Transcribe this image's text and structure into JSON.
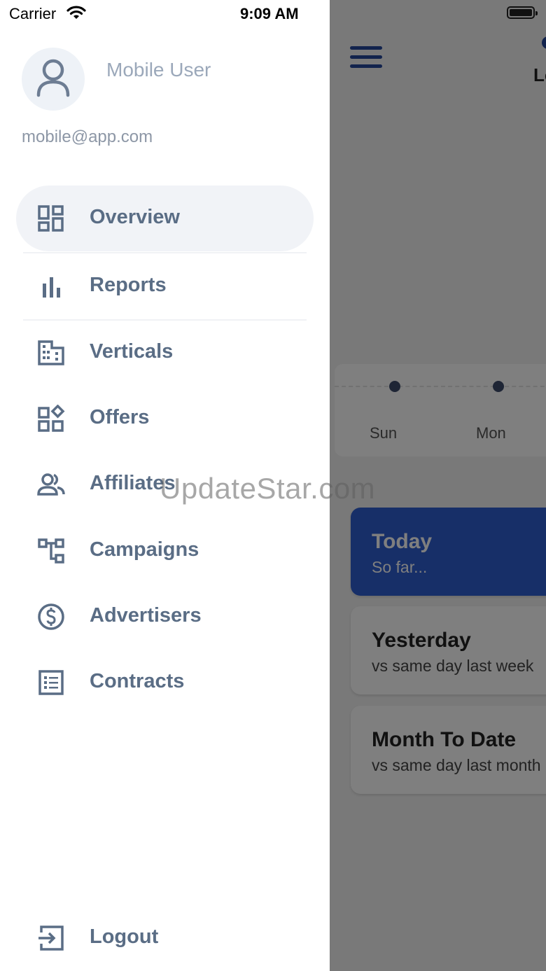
{
  "status_bar": {
    "carrier": "Carrier",
    "time": "9:09 AM"
  },
  "drawer": {
    "user_name": "Mobile User",
    "email": "mobile@app.com",
    "menu": [
      {
        "label": "Overview",
        "icon": "dashboard-icon",
        "active": true
      },
      {
        "label": "Reports",
        "icon": "bar-chart-icon"
      },
      {
        "label": "Verticals",
        "icon": "building-icon"
      },
      {
        "label": "Offers",
        "icon": "widgets-icon"
      },
      {
        "label": "Affiliates",
        "icon": "people-icon"
      },
      {
        "label": "Campaigns",
        "icon": "account-tree-icon"
      },
      {
        "label": "Advertisers",
        "icon": "dollar-circle-icon"
      },
      {
        "label": "Contracts",
        "icon": "list-document-icon"
      }
    ],
    "logout_label": "Logout"
  },
  "background": {
    "header_partial": "Lo",
    "chart_day_labels": [
      "Sun",
      "Mon"
    ],
    "cards": [
      {
        "title": "Today",
        "subtitle": "So far...",
        "active": true
      },
      {
        "title": "Yesterday",
        "subtitle": "vs same day last week"
      },
      {
        "title": "Month To Date",
        "subtitle": "vs same day last month"
      }
    ]
  },
  "watermark": "UpdateStar.com",
  "colors": {
    "accent": "#2f5fd0",
    "menu_text": "#5a6d85",
    "overlay": "rgba(0,0,0,0.5)"
  }
}
